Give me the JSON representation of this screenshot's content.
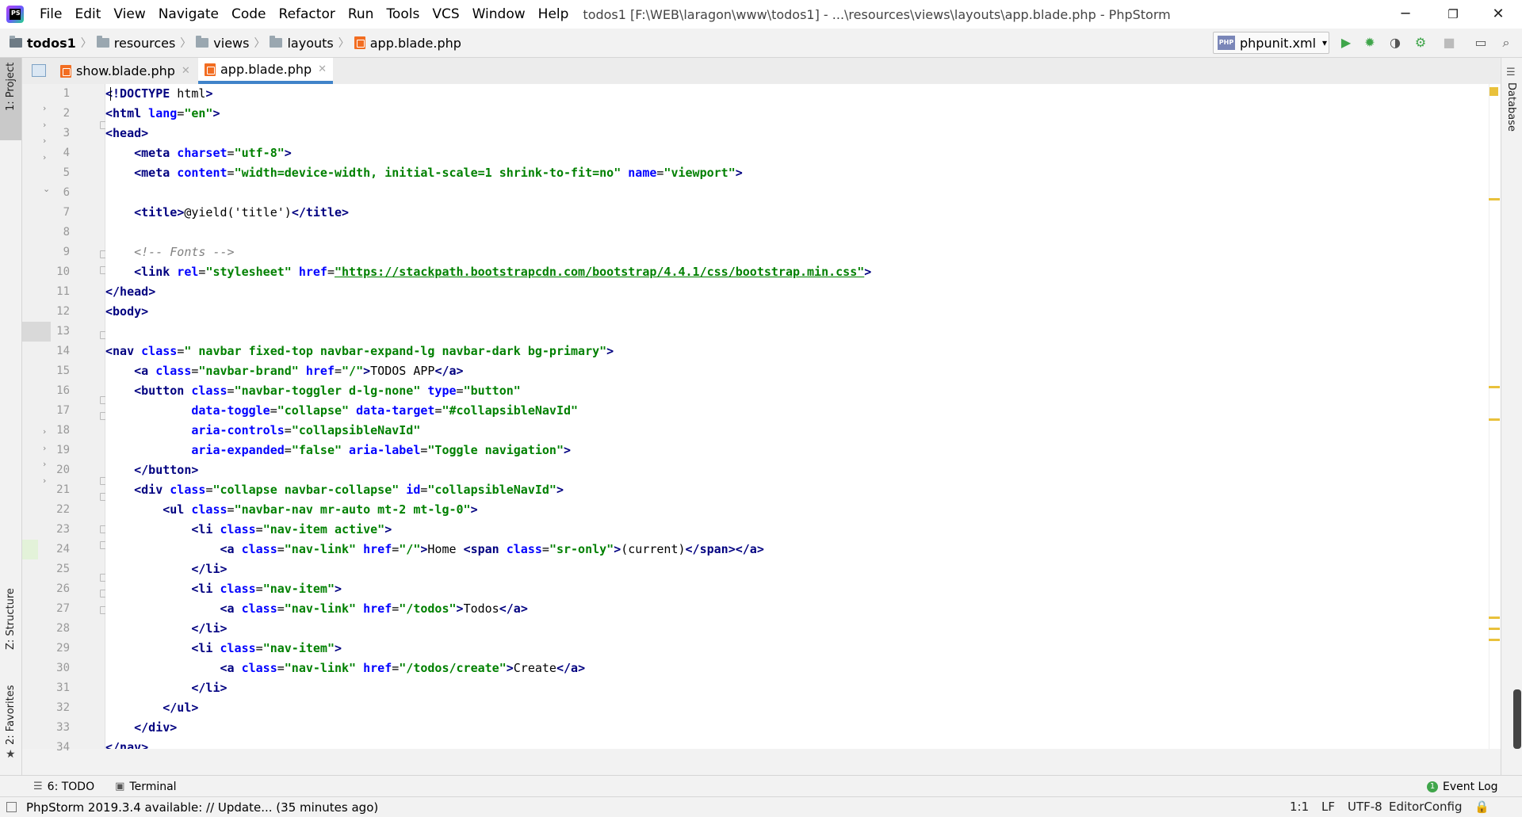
{
  "titlebar": {
    "menu": [
      "File",
      "Edit",
      "View",
      "Navigate",
      "Code",
      "Refactor",
      "Run",
      "Tools",
      "VCS",
      "Window",
      "Help"
    ],
    "window_title": "todos1 [F:\\WEB\\laragon\\www\\todos1] - ...\\resources\\views\\layouts\\app.blade.php - PhpStorm",
    "minimize": "─",
    "maximize": "❐",
    "close": "✕"
  },
  "navbar": {
    "project": "todos1",
    "crumbs": [
      "resources",
      "views",
      "layouts",
      "app.blade.php"
    ],
    "run_config": "phpunit.xml"
  },
  "left_strip": {
    "project": "1: Project",
    "structure": "Z: Structure",
    "favorites": "2: Favorites"
  },
  "right_strip": {
    "database": "Database"
  },
  "tabs": [
    {
      "label": "show.blade.php",
      "active": false
    },
    {
      "label": "app.blade.php",
      "active": true
    }
  ],
  "code_lines": [
    "<!DOCTYPE html>",
    "<html lang=\"en\">",
    "<head>",
    "    <meta charset=\"utf-8\">",
    "    <meta content=\"width=device-width, initial-scale=1 shrink-to-fit=no\" name=\"viewport\">",
    "",
    "    <title>@yield('title')</title>",
    "",
    "    <!-- Fonts -->",
    "    <link rel=\"stylesheet\" href=\"https://stackpath.bootstrapcdn.com/bootstrap/4.4.1/css/bootstrap.min.css\">",
    "</head>",
    "<body>",
    "",
    "<nav class=\" navbar fixed-top navbar-expand-lg navbar-dark bg-primary\">",
    "    <a class=\"navbar-brand\" href=\"/\">TODOS APP</a>",
    "    <button class=\"navbar-toggler d-lg-none\" type=\"button\"",
    "            data-toggle=\"collapse\" data-target=\"#collapsibleNavId\"",
    "            aria-controls=\"collapsibleNavId\"",
    "            aria-expanded=\"false\" aria-label=\"Toggle navigation\">",
    "    </button>",
    "    <div class=\"collapse navbar-collapse\" id=\"collapsibleNavId\">",
    "        <ul class=\"navbar-nav mr-auto mt-2 mt-lg-0\">",
    "            <li class=\"nav-item active\">",
    "                <a class=\"nav-link\" href=\"/\">Home <span class=\"sr-only\">(current)</span></a>",
    "            </li>",
    "            <li class=\"nav-item\">",
    "                <a class=\"nav-link\" href=\"/todos\">Todos</a>",
    "            </li>",
    "            <li class=\"nav-item\">",
    "                <a class=\"nav-link\" href=\"/todos/create\">Create</a>",
    "            </li>",
    "        </ul>",
    "    </div>",
    "</nav>"
  ],
  "bottom_tools": {
    "todo": "6: TODO",
    "terminal": "Terminal",
    "event_log": "Event Log"
  },
  "status": {
    "message": "PhpStorm 2019.3.4 available: // Update... (35 minutes ago)",
    "position": "1:1",
    "line_sep": "LF",
    "encoding": "UTF-8",
    "editor_config": "EditorConfig"
  },
  "colors": {
    "accent": "#4083c9",
    "tag": "#000080",
    "attr": "#0000ff",
    "string": "#008000"
  }
}
